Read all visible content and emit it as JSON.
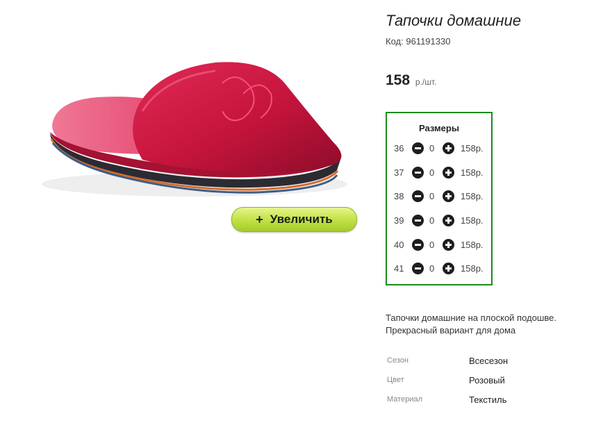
{
  "product": {
    "title": "Тапочки домашние",
    "code_label": "Код:",
    "code_value": "961191330",
    "price": "158",
    "price_unit": "р./шт."
  },
  "zoom_button": {
    "icon": "plus-icon",
    "label": "Увеличить"
  },
  "sizes": {
    "title": "Размеры",
    "rows": [
      {
        "size": "36",
        "qty": "0",
        "price": "158р."
      },
      {
        "size": "37",
        "qty": "0",
        "price": "158р."
      },
      {
        "size": "38",
        "qty": "0",
        "price": "158р."
      },
      {
        "size": "39",
        "qty": "0",
        "price": "158р."
      },
      {
        "size": "40",
        "qty": "0",
        "price": "158р."
      },
      {
        "size": "41",
        "qty": "0",
        "price": "158р."
      }
    ]
  },
  "description": {
    "line1": "Тапочки домашние на плоской подошве.",
    "line2": "Прекрасный вариант для дома"
  },
  "attributes": [
    {
      "label": "Сезон",
      "value": "Всесезон"
    },
    {
      "label": "Цвет",
      "value": "Розовый"
    },
    {
      "label": "Материал",
      "value": "Текстиль"
    }
  ],
  "colors": {
    "accent_border": "#1d8a1d",
    "button_green": "#c4e34a",
    "slipper_red": "#c8163f"
  }
}
